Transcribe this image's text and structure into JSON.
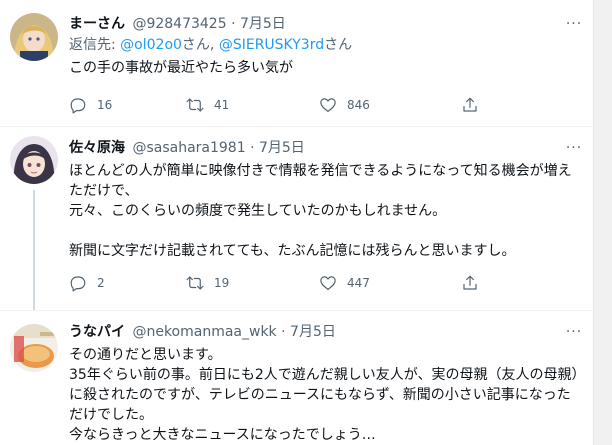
{
  "tweets": [
    {
      "name": "まーさん",
      "handle": "@928473425",
      "dot": "·",
      "date": "7月5日",
      "reply_to": {
        "prefix": "返信先: ",
        "user1": "@ol02o0",
        "mid": "さん, ",
        "user2": "@SIERUSKY3rd",
        "suffix": "さん"
      },
      "text": "この手の事故が最近やたら多い気が",
      "replies": "16",
      "retweets": "41",
      "likes": "846"
    },
    {
      "name": "佐々原海",
      "handle": "@sasahara1981",
      "dot": "·",
      "date": "7月5日",
      "text": "ほとんどの人が簡単に映像付きで情報を発信できるようになって知る機会が増えただけで、\n元々、このくらいの頻度で発生していたのかもしれません。\n\n新聞に文字だけ記載されてても、たぶん記憶には残らんと思いますし。",
      "replies": "2",
      "retweets": "19",
      "likes": "447"
    },
    {
      "name": "うなパイ",
      "handle": "@nekomanmaa_wkk",
      "dot": "·",
      "date": "7月5日",
      "text": "その通りだと思います。\n35年ぐらい前の事。前日にも2人で遊んだ親しい友人が、実の母親（友人の母親）に殺されたのですが、テレビのニュースにもならず、新聞の小さい記事になっただけでした。\n今ならきっと大きなニュースになったでしょう…"
    }
  ],
  "more_label": "···",
  "icons": {
    "reply": "reply-icon",
    "retweet": "retweet-icon",
    "like": "heart-icon",
    "share": "share-icon"
  },
  "colors": {
    "link": "#1d9bf0",
    "secondary": "#536471",
    "thread_line": "#cfd9de"
  }
}
